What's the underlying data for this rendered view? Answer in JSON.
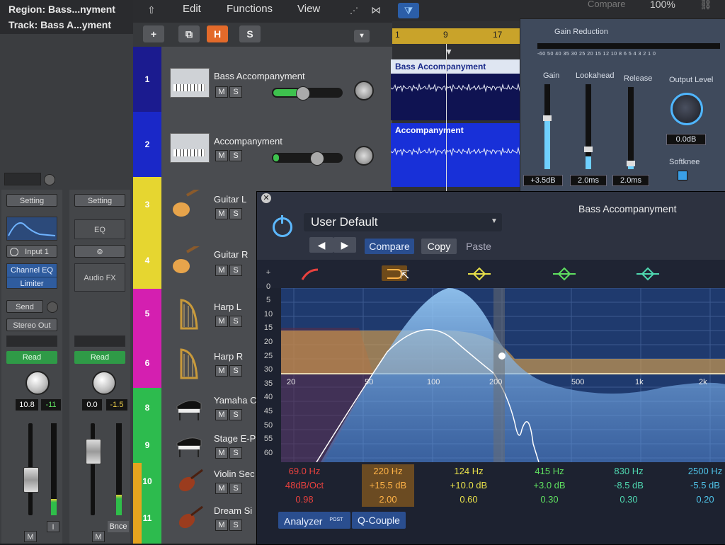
{
  "inspector": {
    "region_line": "Region: Bass...nyment",
    "track_line": "Track: Bass A...yment",
    "strip1": {
      "setting": "Setting",
      "input": "Input 1",
      "inserts": [
        "Channel EQ",
        "Limiter"
      ],
      "send": "Send",
      "output": "Stereo Out",
      "automation": "Read",
      "volume": "10.8",
      "peak": "-11",
      "bottom_buttons": [
        "M"
      ]
    },
    "strip2": {
      "setting": "Setting",
      "eq_label": "EQ",
      "audio_fx": "Audio FX",
      "automation": "Read",
      "volume": "0.0",
      "peak": "-1.5",
      "output_label": "Bnce",
      "bottom_buttons": [
        "M"
      ]
    }
  },
  "menubar": {
    "items": [
      "Edit",
      "Functions",
      "View"
    ],
    "compare": "Compare",
    "zoom": "100%"
  },
  "track_toolbar": {
    "add": "+",
    "h": "H",
    "s": "S"
  },
  "tracks": [
    {
      "num": "1",
      "name": "Bass Accompanyment",
      "color": "#1b1b8f",
      "icon": "synth-icon"
    },
    {
      "num": "2",
      "name": "Accompanyment",
      "color": "#1a28c8",
      "icon": "synth-icon"
    },
    {
      "num": "3",
      "name": "Guitar L",
      "color": "#e6d630",
      "icon": "guitar-icon"
    },
    {
      "num": "4",
      "name": "Guitar R",
      "color": "#e6d630",
      "icon": "guitar-icon"
    },
    {
      "num": "5",
      "name": "Harp L",
      "color": "#d41fb0",
      "icon": "harp-icon"
    },
    {
      "num": "6",
      "name": "Harp R",
      "color": "#d41fb0",
      "icon": "harp-icon"
    },
    {
      "num": "8",
      "name": "Yamaha C",
      "color": "#2dbb4e",
      "icon": "piano-icon"
    },
    {
      "num": "9",
      "name": "Stage E-P",
      "color": "#2dbb4e",
      "icon": "piano-icon"
    },
    {
      "num": "10",
      "name": "Violin Sec",
      "color": "#2dbb4e",
      "icon": "violin-icon"
    },
    {
      "num": "11",
      "name": "Dream Si",
      "color": "#2dbb4e",
      "icon": "violin-icon"
    }
  ],
  "ruler": [
    "1",
    "9",
    "17"
  ],
  "regions": [
    "Bass Accompanyment",
    "Accompanyment"
  ],
  "compressor": {
    "title": "Gain Reduction",
    "scale": "-60 50 40 35 30 25 20 15 12 10 8 6 5 4 3 2 1 0",
    "labels": [
      "Gain",
      "Lookahead",
      "Release",
      "Output Level"
    ],
    "values": [
      "+3.5dB",
      "2.0ms",
      "2.0ms",
      "0.0dB"
    ],
    "softknee": "Softknee"
  },
  "eq": {
    "track_title": "Bass Accompanyment",
    "preset": "User Default",
    "compare": "Compare",
    "copy": "Copy",
    "paste": "Paste",
    "db_scale": [
      "+",
      "0",
      "5",
      "10",
      "15",
      "20",
      "25",
      "30",
      "35",
      "40",
      "45",
      "50",
      "55",
      "60"
    ],
    "freq_labels": [
      "20",
      "50",
      "100",
      "200",
      "500",
      "1k",
      "2k"
    ],
    "bands": [
      {
        "freq": "69.0 Hz",
        "p2": "48dB/Oct",
        "q": "0.98",
        "color": "#e8413e"
      },
      {
        "freq": "220 Hz",
        "p2": "+15.5 dB",
        "q": "2.00",
        "color": "#ffb347"
      },
      {
        "freq": "124 Hz",
        "p2": "+10.0 dB",
        "q": "0.60",
        "color": "#e8e04a"
      },
      {
        "freq": "415 Hz",
        "p2": "+3.0 dB",
        "q": "0.30",
        "color": "#5fe060"
      },
      {
        "freq": "830 Hz",
        "p2": "-8.5 dB",
        "q": "0.30",
        "color": "#4fd8b0"
      },
      {
        "freq": "2500 Hz",
        "p2": "-5.5 dB",
        "q": "0.20",
        "color": "#4fc3e8"
      }
    ],
    "analyzer": "Analyzer",
    "analyzer_badge": "POST",
    "qcouple": "Q-Couple"
  }
}
